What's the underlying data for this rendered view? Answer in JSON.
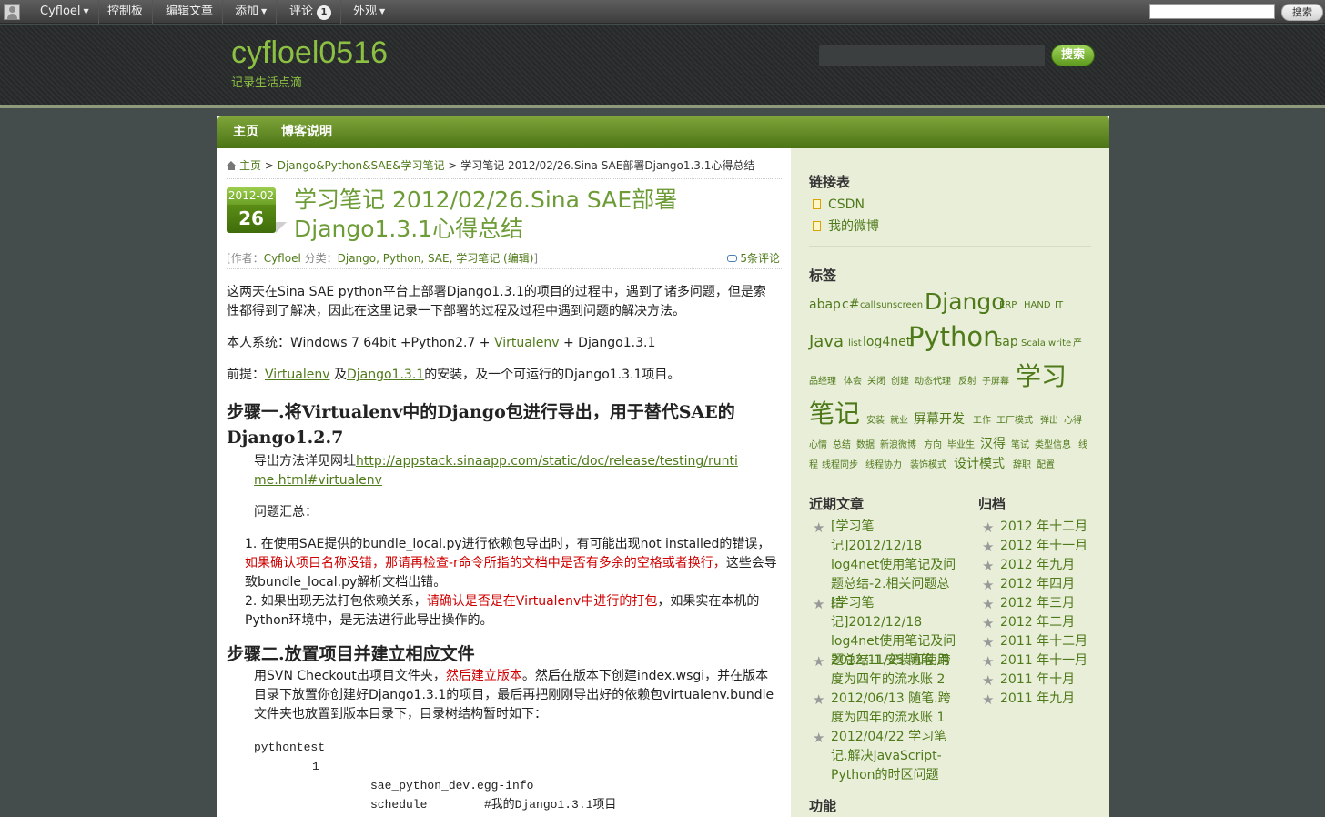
{
  "adminbar": {
    "user": "Cyfloel",
    "dashboard": "控制板",
    "edit_post": "编辑文章",
    "new": "添加",
    "comments": "评论",
    "comments_count": "1",
    "appearance": "外观",
    "search_button": "搜索"
  },
  "header": {
    "site_title": "cyfloel0516",
    "site_description": "记录生活点滴",
    "search_button": "搜索"
  },
  "nav": {
    "home": "主页",
    "about": "博客说明"
  },
  "breadcrumb": {
    "home": "主页",
    "sep1": " > ",
    "category": "Django&Python&SAE&学习笔记",
    "sep2": " > ",
    "current": "学习笔记 2012/02/26.Sina SAE部署Django1.3.1心得总结"
  },
  "post": {
    "date_ym": "2012-02",
    "date_day": "26",
    "title": "学习笔记 2012/02/26.Sina SAE部署Django1.3.1心得总结",
    "meta": {
      "author_prefix": "[作者：",
      "author": "Cyfloel",
      "category_prefix": " 分类：",
      "categories": "Django, Python, SAE, 学习笔记",
      "edit": " (编辑)",
      "suffix": "]"
    },
    "comments": "5条评论",
    "intro": "这两天在Sina SAE python平台上部署Django1.3.1的项目的过程中，遇到了诸多问题，但是索性都得到了解决，因此在这里记录一下部署的过程及过程中遇到问题的解决方法。",
    "system_prefix": "本人系统：Windows 7 64bit +Python2.7 + ",
    "system_link": "Virtualenv",
    "system_suffix": " + Django1.3.1",
    "prereq_prefix": "前提：",
    "prereq_link1": "Virtualenv",
    "prereq_mid": " 及",
    "prereq_link2": "Django1.3.1",
    "prereq_suffix": "的安装，及一个可运行的Django1.3.1项目。",
    "step1_heading": "步骤一.将Virtualenv中的Django包进行导出，用于替代SAE的Django1.2.7",
    "step1_text1": "导出方法详见网址",
    "step1_link": "http://appstack.sinaapp.com/static/doc/release/testing/runtime.html#virtualenv",
    "step1_text2": "问题汇总：",
    "item1_a": "1. 在使用SAE提供的bundle_local.py进行依赖包导出时，有可能出现not installed的错误，",
    "item1_red": "如果确认项目名称没错，那请再检查-r命令所指的文档中是否有多余的空格或者换行，",
    "item1_b": "这些会导致bundle_local.py解析文档出错。",
    "item2_a": "2. 如果出现无法打包依赖关系，",
    "item2_red": "请确认是否是在Virtualenv中进行的打包",
    "item2_b": "，如果实在本机的Python环境中，是无法进行此导出操作的。",
    "step2_heading": "步骤二.放置项目并建立相应文件",
    "step2_a": "用SVN Checkout出项目文件夹，",
    "step2_red": "然后建立版本",
    "step2_b": "。然后在版本下创建index.wsgi，并在版本目录下放置你创建好Django1.3.1的项目，最后再把刚刚导出好的依赖包virtualenv.bundle文件夹也放置到版本目录下，目录树结构暂时如下：",
    "code1": "pythontest",
    "code2": "1",
    "code3": "sae_python_dev.egg-info",
    "code4": "schedule        #我的Django1.3.1项目"
  },
  "sidebar": {
    "links_title": "链接表",
    "links": [
      "CSDN",
      "我的微博"
    ],
    "tags_title": "标签",
    "tags": {
      "abap": "abap",
      "csharp": "c#",
      "call": "call",
      "sunscreen": "sunscreen",
      "django": "Django",
      "erp": "ERP",
      "hand": "HAND",
      "it": "IT",
      "java": "Java",
      "list": "list",
      "log4net": "log4net",
      "python": "Python",
      "sap": "sap",
      "scala": "Scala",
      "write": "write",
      "chan": "产",
      "pinjingli": "品经理",
      "tihui": "体会",
      "guanbi": "关闭",
      "chuangjian": "创建",
      "dongtai": "动态代理",
      "fanshe": "反射",
      "zipingmu": "子屏幕",
      "xuexi1": "学习",
      "xuexi2": "笔记",
      "anzhuang": "安装",
      "jiuye": "就业",
      "pingmu": "屏幕开发",
      "gongzuo": "工作",
      "gongchang": "工厂模式",
      "tanchu": "弹出",
      "xinde": "心得",
      "xinqing": "心情",
      "zongjie": "总结",
      "shuju": "数据",
      "xinlang": "新浪微博",
      "fangxiang": "方向",
      "biye": "毕业生",
      "hanyu": "汉得",
      "bishi": "笔试",
      "leixing": "类型信息",
      "xian": "线",
      "cheng": "程",
      "xianchengtongbu": "线程同步",
      "xianchengxiezuo": "线程协力",
      "zhuangshi": "装饰模式",
      "sheji": "设计模式",
      "cipin": "辞职",
      "peizhi": "配置"
    },
    "recent_title": "近期文章",
    "recent": [
      "[学习笔记]2012/12/18 log4net使用笔记及问题总结-2.相关问题总结",
      "[学习笔记]2012/12/18 log4net使用笔记及问题总结-1.安装和使用",
      "2012/11/25 随笔.跨度为四年的流水账 2",
      "2012/06/13 随笔.跨度为四年的流水账 1",
      "2012/04/22 学习笔记.解决JavaScript-Python的时区问题"
    ],
    "archive_title": "归档",
    "archives": [
      "2012 年十二月",
      "2012 年十一月",
      "2012 年九月",
      "2012 年四月",
      "2012 年三月",
      "2012 年二月",
      "2011 年十二月",
      "2011 年十一月",
      "2011 年十月",
      "2011 年九月"
    ],
    "meta_title": "功能"
  }
}
